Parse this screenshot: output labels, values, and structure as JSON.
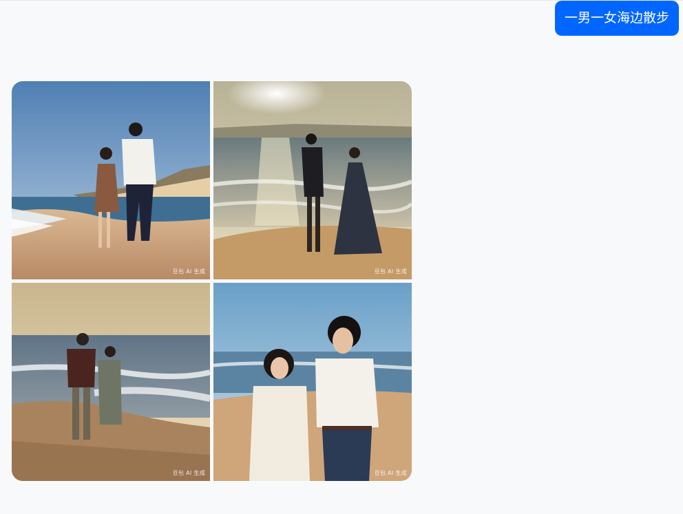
{
  "conversation": {
    "user_message": "一男一女海边散步"
  },
  "images": [
    {
      "name": "beach-couple-holding-hands",
      "watermark": "豆包 AI 生成"
    },
    {
      "name": "beach-couple-sunset-walk",
      "watermark": "豆包 AI 生成"
    },
    {
      "name": "beach-couple-back-view",
      "watermark": "豆包 AI 生成"
    },
    {
      "name": "beach-couple-closeup",
      "watermark": "豆包 AI 生成"
    }
  ],
  "colors": {
    "bubble": "#0066ff",
    "background": "#f8f9fb"
  }
}
